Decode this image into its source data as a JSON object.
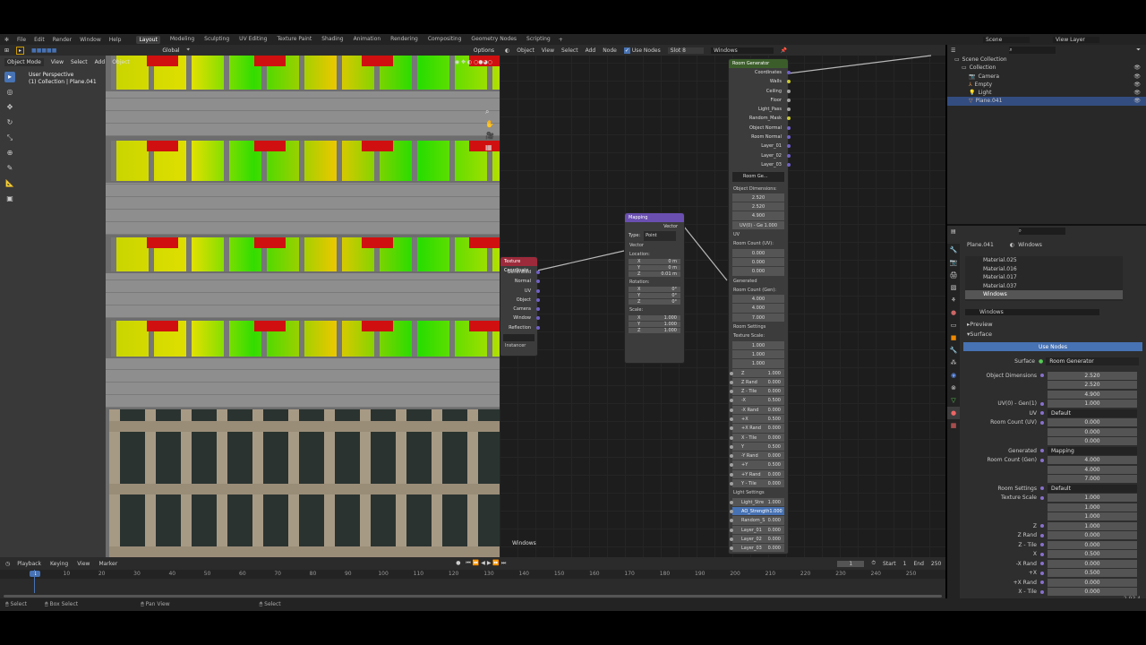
{
  "menu": {
    "items": [
      "File",
      "Edit",
      "Render",
      "Window",
      "Help"
    ],
    "workspaces": [
      "Layout",
      "Modeling",
      "Sculpting",
      "UV Editing",
      "Texture Paint",
      "Shading",
      "Animation",
      "Rendering",
      "Compositing",
      "Geometry Nodes",
      "Scripting"
    ],
    "add": "+"
  },
  "viewport": {
    "mode": "Object Mode",
    "menus": [
      "View",
      "Select",
      "Add",
      "Object"
    ],
    "orientation": "Global",
    "options": "Options",
    "perspective": "User Perspective",
    "collection": "(1) Collection | Plane.041"
  },
  "node_editor": {
    "type": "Object",
    "menus": [
      "View",
      "Select",
      "Add",
      "Node"
    ],
    "use_nodes": "Use Nodes",
    "slot": "Slot 8",
    "material": "Windows",
    "footer_label": "Windows"
  },
  "tex_coord": {
    "title": "Texture Coordinate",
    "outputs": [
      "Generated",
      "Normal",
      "UV",
      "Object",
      "Camera",
      "Window",
      "Reflection"
    ],
    "instancer": "Instancer"
  },
  "mapping": {
    "title": "Mapping",
    "out": "Vector",
    "type_label": "Type:",
    "type": "Point",
    "vector": "Vector",
    "location": "Location:",
    "loc": [
      [
        "X",
        "0 m"
      ],
      [
        "Y",
        "0 m"
      ],
      [
        "Z",
        "0.01 m"
      ]
    ],
    "rotation": "Rotation:",
    "rot": [
      [
        "X",
        "0°"
      ],
      [
        "Y",
        "0°"
      ],
      [
        "Z",
        "0°"
      ]
    ],
    "scale": "Scale:",
    "scl": [
      [
        "X",
        "1.000"
      ],
      [
        "Y",
        "1.000"
      ],
      [
        "Z",
        "1.000"
      ]
    ]
  },
  "room_gen": {
    "title": "Room Generator",
    "outputs": [
      "Coordinates",
      "Walls",
      "Ceiling",
      "Floor",
      "Light_Pass",
      "Random_Mask",
      "Object Normal",
      "Room Normal",
      "Layer_01",
      "Layer_02",
      "Layer_03"
    ],
    "group": "Room Ge...",
    "obj_dim_label": "Object Dimensions:",
    "obj_dim": [
      "2.520",
      "2.520",
      "4.900"
    ],
    "uv_gen": "UV(0) - Ge  1.000",
    "uv": "UV",
    "room_uv_label": "Room Count (UV):",
    "room_uv": [
      "0.000",
      "0.000",
      "0.000"
    ],
    "generated": "Generated",
    "room_gen_label": "Room Count (Gen):",
    "room_gen": [
      "4.000",
      "4.000",
      "7.000"
    ],
    "room_settings": "Room Settings",
    "tex_scale_label": "Texture Scale:",
    "tex_scale": [
      "1.000",
      "1.000",
      "1.000"
    ],
    "params": [
      [
        "Z",
        "1.000"
      ],
      [
        "Z Rand",
        "0.000"
      ],
      [
        "Z - Tile",
        "0.000"
      ],
      [
        "-X",
        "0.500"
      ],
      [
        "-X Rand",
        "0.000"
      ],
      [
        "+X",
        "0.500"
      ],
      [
        "+X Rand",
        "0.000"
      ],
      [
        "X - Tile",
        "0.000"
      ],
      [
        "Y",
        "0.500"
      ],
      [
        "-Y Rand",
        "0.000"
      ],
      [
        "+Y",
        "0.500"
      ],
      [
        "+Y Rand",
        "0.000"
      ],
      [
        "Y - Tile",
        "0.000"
      ]
    ],
    "light_settings": "Light Settings",
    "lights": [
      [
        "Light_Stre",
        "1.000"
      ],
      [
        "AO_Strength",
        "1.000"
      ],
      [
        "Random_S",
        "0.000"
      ],
      [
        "Layer_01",
        "0.000"
      ],
      [
        "Layer_02",
        "0.000"
      ],
      [
        "Layer_03",
        "0.000"
      ]
    ]
  },
  "outliner": {
    "scene": "Scene",
    "view_layer": "View Layer",
    "items": [
      "Scene Collection",
      "Collection",
      "Camera",
      "Empty",
      "Light",
      "Plane.041"
    ]
  },
  "properties": {
    "object": "Plane.041",
    "material": "Windows",
    "slots": [
      "Material.025",
      "Material.016",
      "Material.017",
      "Material.037",
      "Windows"
    ],
    "mat_name": "Windows",
    "preview": "Preview",
    "surface_panel": "Surface",
    "use_nodes": "Use Nodes",
    "surface_label": "Surface",
    "surface_value": "Room Generator",
    "rows": [
      [
        "Object Dimensions",
        "2.520"
      ],
      [
        "",
        "2.520"
      ],
      [
        "",
        "4.900"
      ],
      [
        "UV(0) - Gen(1)",
        "1.000"
      ],
      [
        "UV",
        "Default"
      ],
      [
        "Room Count (UV)",
        "0.000"
      ],
      [
        "",
        "0.000"
      ],
      [
        "",
        "0.000"
      ],
      [
        "Generated",
        "Mapping"
      ],
      [
        "Room Count (Gen)",
        "4.000"
      ],
      [
        "",
        "4.000"
      ],
      [
        "",
        "7.000"
      ],
      [
        "Room Settings",
        "Default"
      ],
      [
        "Texture Scale",
        "1.000"
      ],
      [
        "",
        "1.000"
      ],
      [
        "",
        "1.000"
      ],
      [
        "Z",
        "1.000"
      ],
      [
        "Z Rand",
        "0.000"
      ],
      [
        "Z - Tile",
        "0.000"
      ],
      [
        "X",
        "0.500"
      ],
      [
        "-X Rand",
        "0.000"
      ],
      [
        "+X",
        "0.500"
      ],
      [
        "+X Rand",
        "0.000"
      ],
      [
        "X - Tile",
        "0.000"
      ]
    ]
  },
  "timeline": {
    "menus": [
      "Playback",
      "Keying",
      "View",
      "Marker"
    ],
    "current": "1",
    "start_label": "Start",
    "start": "1",
    "end_label": "End",
    "end": "250",
    "ticks": [
      "1",
      "10",
      "20",
      "30",
      "40",
      "50",
      "60",
      "70",
      "80",
      "90",
      "100",
      "110",
      "120",
      "130",
      "140",
      "150",
      "160",
      "170",
      "180",
      "190",
      "200",
      "210",
      "220",
      "230",
      "240",
      "250"
    ]
  },
  "status": {
    "items": [
      "Select",
      "Box Select",
      "Pan View",
      "Select"
    ],
    "version": "2.93.4"
  },
  "colors": {
    "accent": "#4772b3",
    "tex_coord_header": "#9c2a3a",
    "mapping_header": "#6a4fb0",
    "group_header": "#3b5d2a"
  }
}
